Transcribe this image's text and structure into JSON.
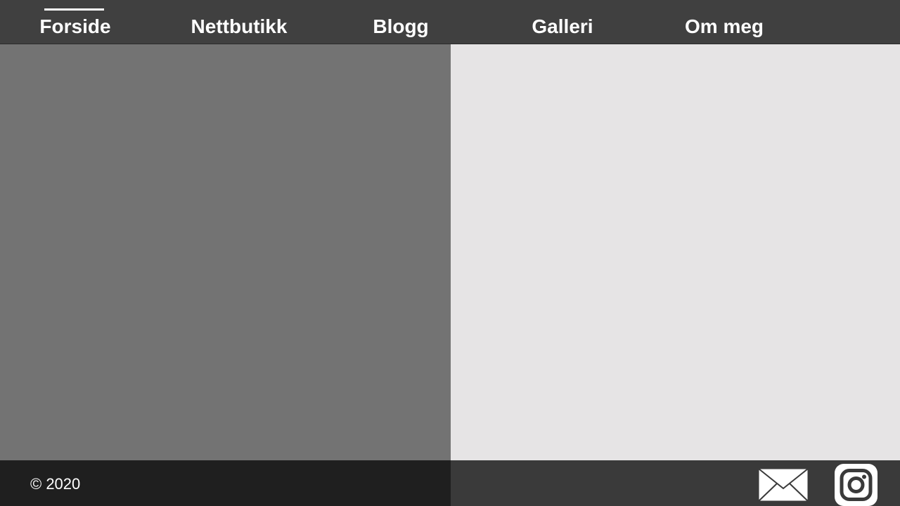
{
  "nav": {
    "items": [
      {
        "label": "Forside",
        "active": true
      },
      {
        "label": "Nettbutikk",
        "active": false
      },
      {
        "label": "Blogg",
        "active": false
      },
      {
        "label": "Galleri",
        "active": false
      },
      {
        "label": "Om meg",
        "active": false
      }
    ]
  },
  "footer": {
    "copyright": "© 2020",
    "icons": [
      "mail-icon",
      "instagram-icon"
    ]
  },
  "colors": {
    "nav_bg": "#404040",
    "left_panel": "#737373",
    "right_panel": "#e6e4e5",
    "footer_left": "#1f1f1f",
    "footer_right": "#3a3a3a",
    "text": "#ffffff"
  }
}
